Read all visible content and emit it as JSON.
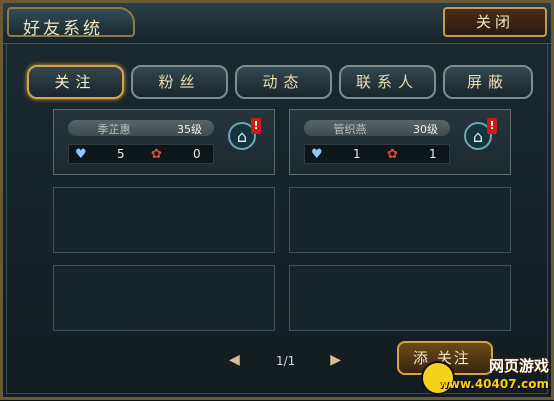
{
  "window": {
    "title": "好友系统",
    "close_label": "关闭"
  },
  "tabs": [
    {
      "label": "关注",
      "active": true
    },
    {
      "label": "粉丝",
      "active": false
    },
    {
      "label": "动态",
      "active": false
    },
    {
      "label": "联系人",
      "active": false
    },
    {
      "label": "屏蔽",
      "active": false
    }
  ],
  "friends": [
    {
      "name": "季芷惠",
      "level": "35级",
      "likes": "5",
      "flowers": "0"
    },
    {
      "name": "管织燕",
      "level": "30级",
      "likes": "1",
      "flowers": "1"
    }
  ],
  "pagination": {
    "page": "1/1"
  },
  "actions": {
    "add_button_label": "添 关注"
  },
  "watermark": {
    "top": "网页游戏",
    "bottom": "www.40407.com"
  },
  "icons": {
    "alert": "!",
    "prev": "◀",
    "next": "▶"
  }
}
